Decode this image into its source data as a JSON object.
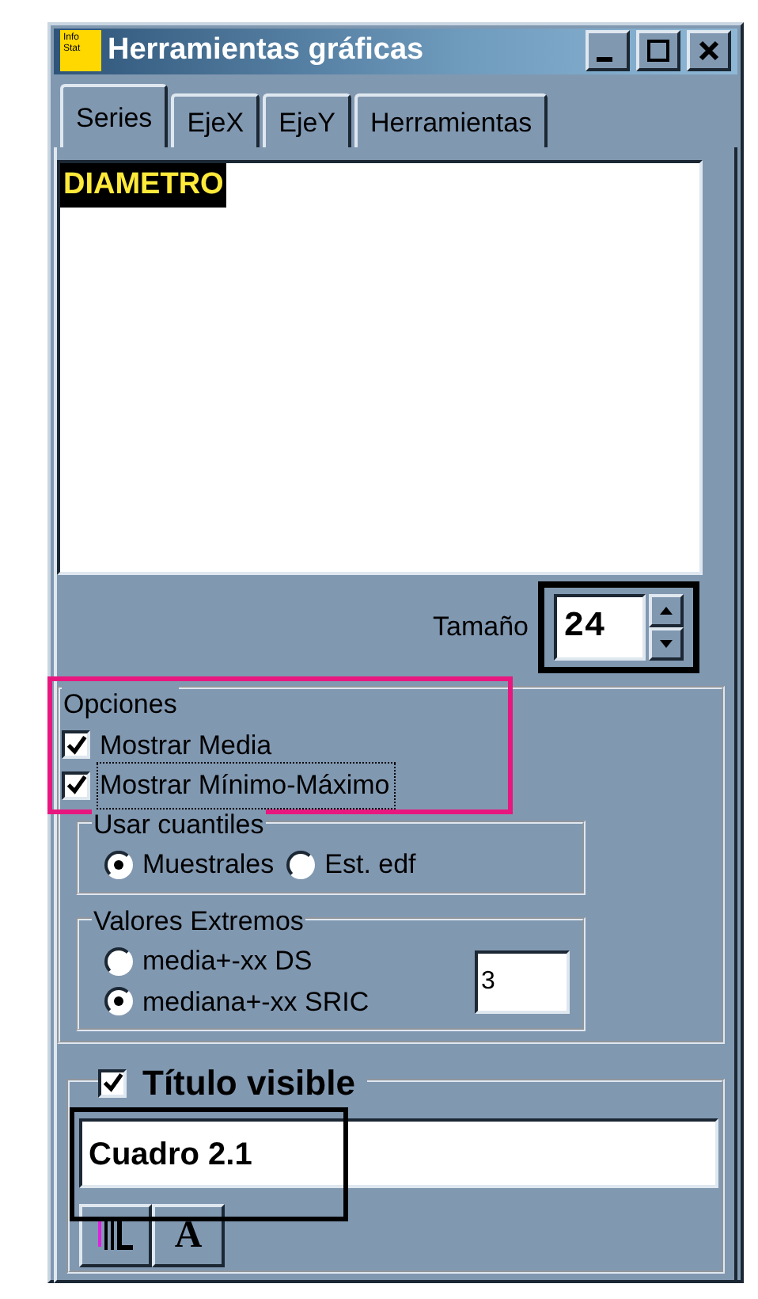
{
  "window": {
    "title": "Herramientas gráficas",
    "logo_lines": [
      "Info",
      "Stat"
    ]
  },
  "title_buttons": [
    {
      "kind": "minimize"
    },
    {
      "kind": "maximize"
    },
    {
      "kind": "close"
    }
  ],
  "tabs": [
    {
      "label": "Series",
      "selected": true
    },
    {
      "label": "EjeX",
      "selected": false
    },
    {
      "label": "EjeY",
      "selected": false
    },
    {
      "label": "Herramientas",
      "selected": false
    }
  ],
  "series_list": [
    {
      "label": "DIAMETRO",
      "selected": true
    }
  ],
  "size": {
    "label": "Tamaño",
    "value": "24",
    "frame": {
      "color": "#000000"
    }
  },
  "options": {
    "title": "Opciones",
    "frame": {
      "color": "#e8177f"
    },
    "checkboxes": [
      {
        "label": "Mostrar Media",
        "checked": true,
        "focused": false
      },
      {
        "label": "Mostrar Mínimo-Máximo",
        "checked": true,
        "focused": true
      }
    ]
  },
  "quantiles": {
    "title": "Usar cuantiles",
    "radios": [
      {
        "label": "Muestrales",
        "selected": true
      },
      {
        "label": "Est. edf",
        "selected": false
      }
    ]
  },
  "extremes": {
    "title": "Valores Extremos",
    "value": "3",
    "radios": [
      {
        "label": "media+-xx DS",
        "selected": false
      },
      {
        "label": "mediana+-xx SRIC",
        "selected": true
      }
    ]
  },
  "title_section": {
    "label": "Título visible",
    "checked": true,
    "value": "Cuadro 2.1",
    "frame": {
      "color": "#000000"
    }
  },
  "toolbar": [
    {
      "kind": "lines"
    },
    {
      "kind": "font",
      "label": "A"
    }
  ]
}
